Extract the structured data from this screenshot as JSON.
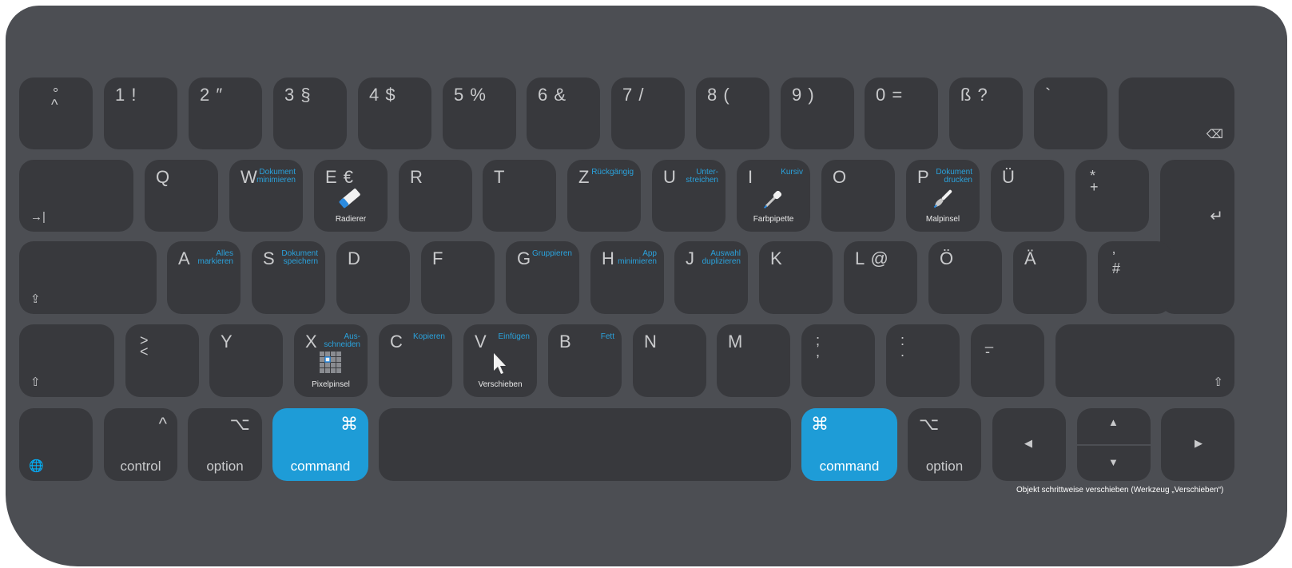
{
  "row1": [
    {
      "id": "circumflex",
      "top": "°",
      "bottom": "^"
    },
    {
      "id": "1",
      "label": "1 !"
    },
    {
      "id": "2",
      "label": "2 ″"
    },
    {
      "id": "3",
      "label": "3 §"
    },
    {
      "id": "4",
      "label": "4 $"
    },
    {
      "id": "5",
      "label": "5 %"
    },
    {
      "id": "6",
      "label": "6 &"
    },
    {
      "id": "7",
      "label": "7 /"
    },
    {
      "id": "8",
      "label": "8 ("
    },
    {
      "id": "9",
      "label": "9 )"
    },
    {
      "id": "0",
      "label": "0 ="
    },
    {
      "id": "sz",
      "label": "ß ?"
    },
    {
      "id": "acute",
      "label": "`"
    }
  ],
  "row1_extra": {
    "backspace_icon": "⌫"
  },
  "row2": {
    "tab_icon": "→|",
    "keys": [
      {
        "id": "q",
        "label": "Q"
      },
      {
        "id": "w",
        "label": "W",
        "shortcut": "Dokument\nminimieren"
      },
      {
        "id": "e",
        "label": "E €",
        "tool": "Radierer",
        "tool_icon": "eraser-icon"
      },
      {
        "id": "r",
        "label": "R"
      },
      {
        "id": "t",
        "label": "T"
      },
      {
        "id": "z",
        "label": "Z",
        "shortcut": "Rückgängig"
      },
      {
        "id": "u",
        "label": "U",
        "shortcut": "Unter-\nstreichen"
      },
      {
        "id": "i",
        "label": "I",
        "shortcut": "Kursiv",
        "tool": "Farbpipette",
        "tool_icon": "eyedropper-icon"
      },
      {
        "id": "o",
        "label": "O"
      },
      {
        "id": "p",
        "label": "P",
        "shortcut": "Dokument\ndrucken",
        "tool": "Malpinsel",
        "tool_icon": "paintbrush-icon"
      },
      {
        "id": "ue",
        "label": "Ü"
      },
      {
        "id": "plus",
        "top": "*",
        "bottom": "+"
      }
    ],
    "return_icon": "↵"
  },
  "row3": {
    "caps_icon": "⇪",
    "keys": [
      {
        "id": "a",
        "label": "A",
        "shortcut": "Alles\nmarkieren"
      },
      {
        "id": "s",
        "label": "S",
        "shortcut": "Dokument\nspeichern"
      },
      {
        "id": "d",
        "label": "D"
      },
      {
        "id": "f",
        "label": "F"
      },
      {
        "id": "g",
        "label": "G",
        "shortcut": "Gruppieren"
      },
      {
        "id": "h",
        "label": "H",
        "shortcut": "App\nminimieren"
      },
      {
        "id": "j",
        "label": "J",
        "shortcut": "Auswahl\nduplizieren"
      },
      {
        "id": "k",
        "label": "K"
      },
      {
        "id": "l",
        "label": "L @"
      },
      {
        "id": "oe",
        "label": "Ö"
      },
      {
        "id": "ae",
        "label": "Ä"
      },
      {
        "id": "hash",
        "top": "’",
        "bottom": "#"
      }
    ]
  },
  "row4": {
    "shift_icon": "⇧",
    "keys": [
      {
        "id": "angle",
        "top": ">",
        "bottom": "<"
      },
      {
        "id": "y",
        "label": "Y"
      },
      {
        "id": "x",
        "label": "X",
        "shortcut": "Aus-\nschneiden",
        "tool": "Pixelpinsel",
        "tool_icon": "pixel-brush-icon"
      },
      {
        "id": "c",
        "label": "C",
        "shortcut": "Kopieren"
      },
      {
        "id": "v",
        "label": "V",
        "shortcut": "Einfügen",
        "tool": "Verschieben",
        "tool_icon": "move-cursor-icon"
      },
      {
        "id": "b",
        "label": "B",
        "shortcut": "Fett"
      },
      {
        "id": "n",
        "label": "N"
      },
      {
        "id": "m",
        "label": "M"
      },
      {
        "id": "semi",
        "top": ";",
        "bottom": ","
      },
      {
        "id": "colon",
        "top": ":",
        "bottom": "."
      },
      {
        "id": "under",
        "top": "_",
        "bottom": "-"
      }
    ],
    "shift_right_icon": "⇧"
  },
  "row5": {
    "globe_icon": "🌐",
    "control": {
      "label": "control",
      "symbol": "^"
    },
    "option_left": {
      "label": "option",
      "symbol": "⌥"
    },
    "command_left": {
      "label": "command",
      "symbol": "⌘"
    },
    "command_right": {
      "label": "command",
      "symbol": "⌘"
    },
    "option_right": {
      "label": "option",
      "symbol": "⌥"
    },
    "arrows": {
      "left": "◀",
      "up": "▲",
      "down": "▼",
      "right": "▶"
    }
  },
  "caption": "Objekt schrittweise verschieben (Werkzeug „Verschieben“)",
  "colors": {
    "keyboard": "#4c4e53",
    "key": "#38393d",
    "accent": "#1e9cd7",
    "shortcut_text": "#2aa2dc"
  }
}
